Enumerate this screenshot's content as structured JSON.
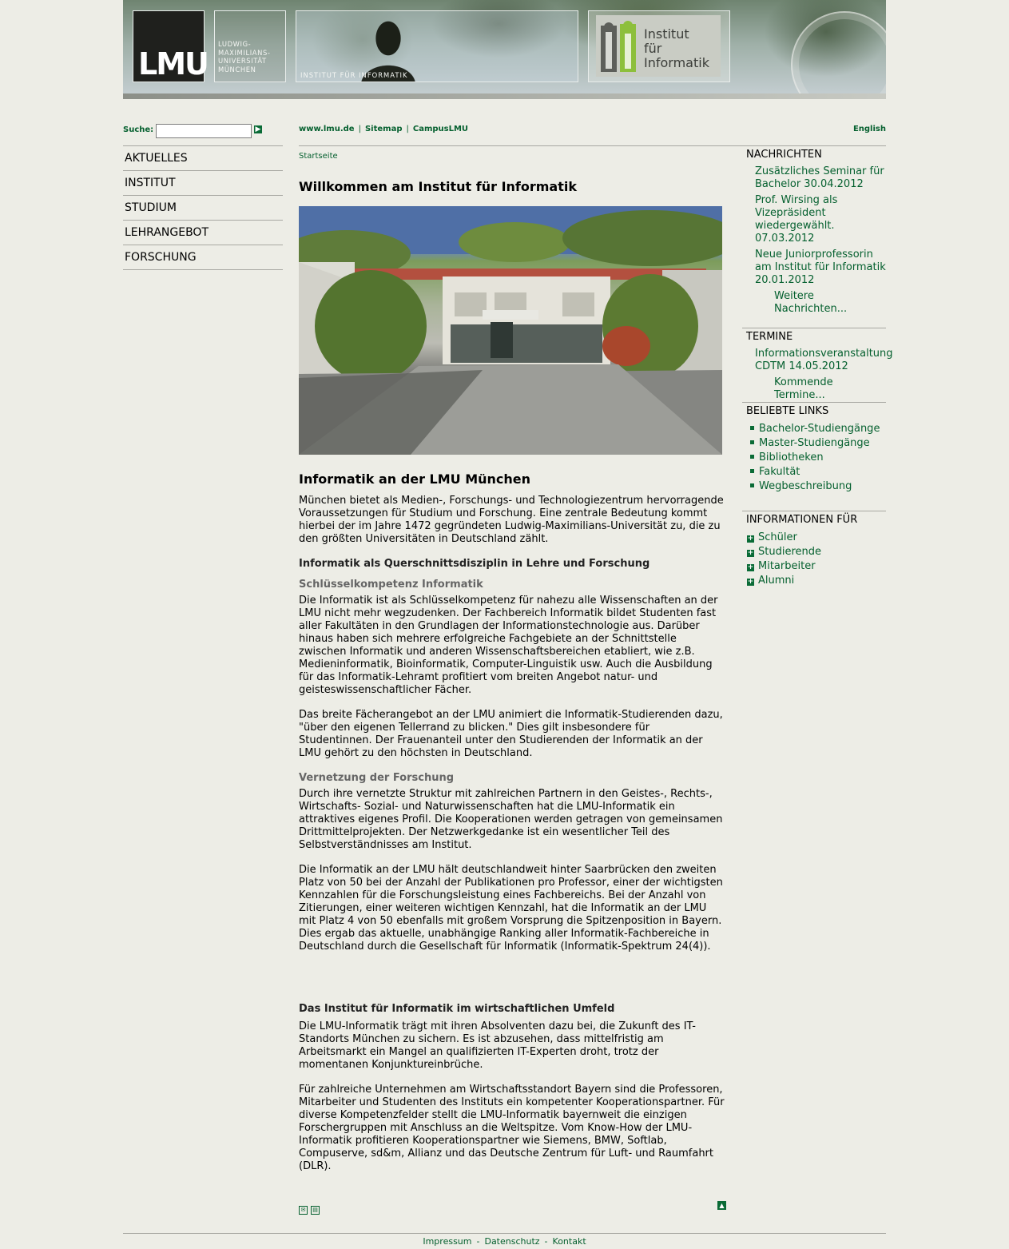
{
  "header": {
    "lmu_logo": "LMU",
    "university_name": [
      "LUDWIG-",
      "MAXIMILIANS-",
      "UNIVERSITÄT",
      "MÜNCHEN"
    ],
    "institute_label": "INSTITUT FÜR INFORMATIK",
    "ifi_logo_text": [
      "Institut",
      "für",
      "Informatik"
    ]
  },
  "search": {
    "label": "Suche:",
    "value": "",
    "go_icon": "arrow-right-icon"
  },
  "nav": {
    "items": [
      "AKTUELLES",
      "INSTITUT",
      "STUDIUM",
      "LEHRANGEBOT",
      "FORSCHUNG"
    ]
  },
  "toplinks": {
    "items": [
      "www.lmu.de",
      "Sitemap",
      "CampusLMU"
    ],
    "separator": "|",
    "language": "English"
  },
  "main": {
    "breadcrumb": "Startseite",
    "title": "Willkommen am Institut für Informatik",
    "heading": "Informatik an der LMU München",
    "intro": "München bietet als Medien-, Forschungs- und Technologiezentrum hervorragende Voraussetzungen für Studium und Forschung. Eine zentrale Bedeutung kommt hierbei der im Jahre 1472 gegründeten Ludwig-Maximilians-Universität zu, die zu den größten Universitäten in Deutschland zählt.",
    "section1_title": "Informatik als Querschnittsdisziplin in Lehre und Forschung",
    "sub1_title": "Schlüsselkompetenz Informatik",
    "sub1_p1": "Die Informatik ist als Schlüsselkompetenz für nahezu alle Wissenschaften an der LMU nicht mehr wegzudenken. Der Fachbereich Informatik bildet Studenten fast aller Fakultäten in den Grundlagen der Informationstechnologie aus. Darüber hinaus haben sich mehrere erfolgreiche Fachgebiete an der Schnittstelle zwischen Informatik und anderen Wissenschaftsbereichen etabliert, wie z.B. Medieninformatik, Bioinformatik, Computer-Linguistik usw. Auch die Ausbildung für das Informatik-Lehramt profitiert vom breiten Angebot natur- und geisteswissenschaftlicher Fächer.",
    "sub1_p2": "Das breite Fächerangebot an der LMU animiert die Informatik-Studierenden dazu, \"über den eigenen Tellerrand zu blicken.\" Dies gilt insbesondere für Studentinnen. Der Frauenanteil unter den Studierenden der Informatik an der LMU gehört zu den höchsten in Deutschland.",
    "sub2_title": "Vernetzung der Forschung",
    "sub2_p1": "Durch ihre vernetzte Struktur mit zahlreichen Partnern in den Geistes-, Rechts-, Wirtschafts- Sozial- und Naturwissenschaften hat die LMU-Informatik ein attraktives eigenes Profil. Die Kooperationen werden getragen von gemeinsamen Drittmittelprojekten. Der Netzwerkgedanke ist ein wesentlicher Teil des Selbstverständnisses am Institut.",
    "sub2_p2": "Die Informatik an der LMU hält deutschlandweit hinter Saarbrücken den zweiten Platz von 50 bei der Anzahl der Publikationen pro Professor, einer der wichtigsten Kennzahlen für die Forschungsleistung eines Fachbereichs. Bei der Anzahl von Zitierungen, einer weiteren wichtigen Kennzahl, hat die Informatik an der LMU mit Platz 4 von 50 ebenfalls mit großem Vorsprung die Spitzenposition in Bayern. Dies ergab das aktuelle, unabhängige Ranking aller Informatik-Fachbereiche in Deutschland durch die Gesellschaft für Informatik (Informatik-Spektrum 24(4)).",
    "section2_title": "Das Institut für Informatik im wirtschaftlichen Umfeld",
    "sec2_p1": "Die LMU-Informatik trägt mit ihren Absolventen dazu bei, die Zukunft des IT-Standorts München zu sichern. Es ist abzusehen, dass mittelfristig am Arbeitsmarkt ein Mangel an qualifizierten IT-Experten droht, trotz der momentanen Konjunktureinbrüche.",
    "sec2_p2": "Für zahlreiche Unternehmen am Wirtschaftsstandort Bayern sind die Professoren, Mitarbeiter und Studenten des Instituts ein kompetenter Kooperationspartner. Für diverse Kompetenzfelder stellt die LMU-Informatik bayernweit die einzigen Forschergruppen mit Anschluss an die Weltspitze. Vom Know-How der LMU-Informatik profitieren Kooperationspartner wie Siemens, BMW, Softlab, Compuserve, sd&m, Allianz und das Deutsche Zentrum für Luft- und Raumfahrt (DLR).",
    "icons": [
      "mail-icon",
      "print-icon",
      "back-to-top-icon"
    ]
  },
  "sidebar": {
    "news_title": "NACHRICHTEN",
    "news": [
      "Zusätzliches Seminar für Bachelor 30.04.2012",
      "Prof. Wirsing als Vizepräsident wiedergewählt. 07.03.2012",
      "Neue Juniorprofessorin am Institut für Informatik 20.01.2012"
    ],
    "news_more": "Weitere Nachrichten...",
    "events_title": "TERMINE",
    "events": [
      "Informationsveranstaltung CDTM 14.05.2012"
    ],
    "events_more": "Kommende Termine...",
    "links_title": "BELIEBTE LINKS",
    "links": [
      "Bachelor-Studiengänge",
      "Master-Studiengänge",
      "Bibliotheken",
      "Fakultät",
      "Wegbeschreibung"
    ],
    "info_title": "INFORMATIONEN FÜR",
    "info": [
      "Schüler",
      "Studierende",
      "Mitarbeiter",
      "Alumni"
    ]
  },
  "footer": {
    "links": [
      "Impressum",
      "Datenschutz",
      "Kontakt"
    ],
    "separator": "-"
  },
  "colors": {
    "link": "#05602f",
    "background": "#edede6",
    "rule": "#a8a8a2"
  }
}
